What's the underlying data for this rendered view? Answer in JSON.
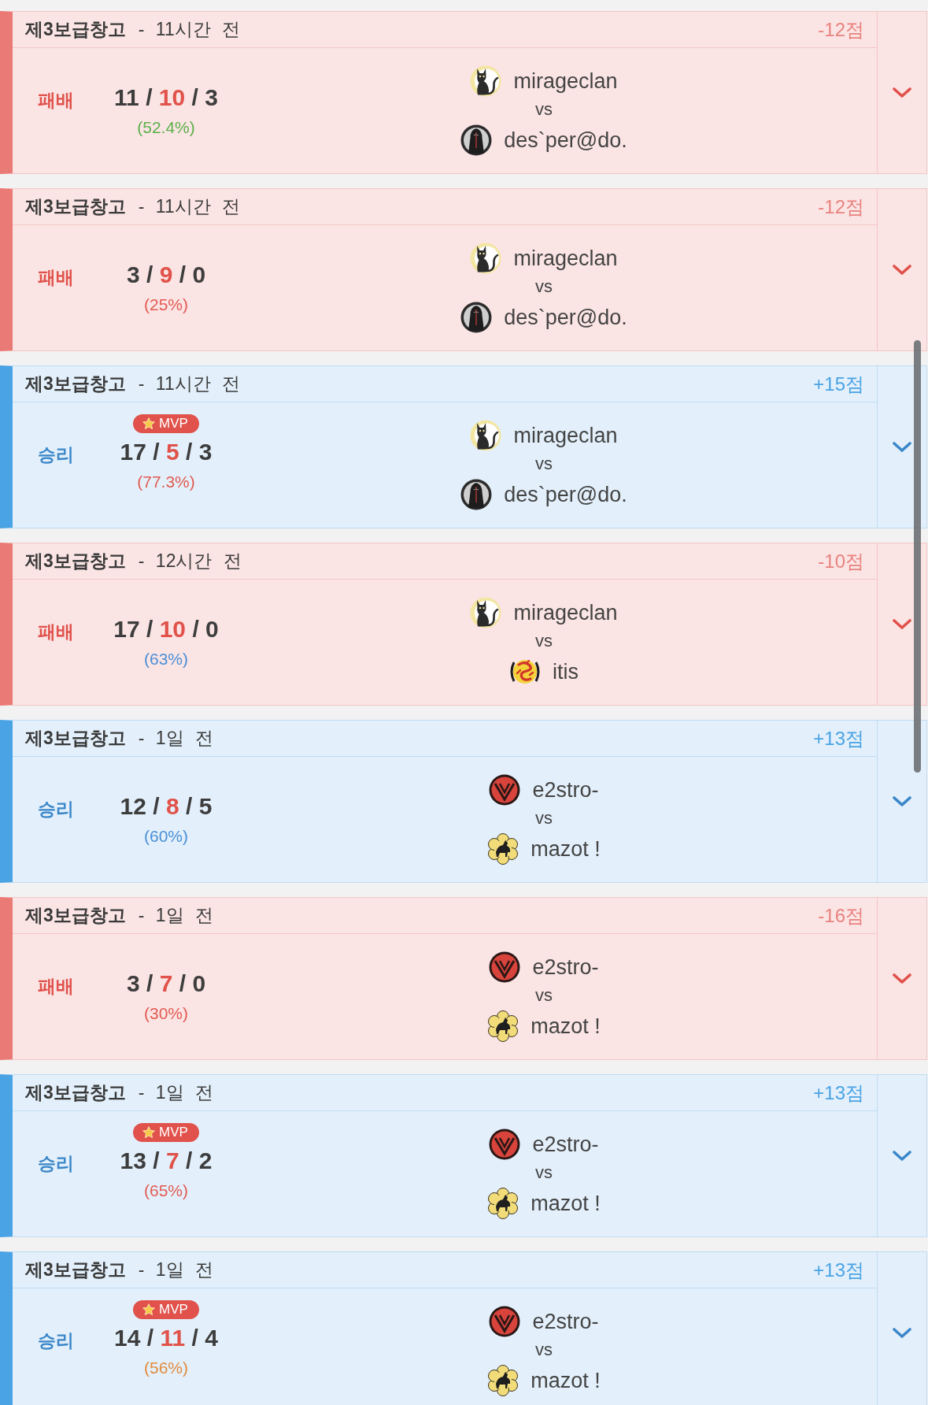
{
  "matches": [
    {
      "kind": "loss",
      "map": "제3보급창고",
      "time": "- 11시간 전",
      "score": "-12점",
      "result": "패배",
      "kda": [
        {
          "kind": "kills",
          "text": "11"
        },
        {
          "kind": "sep",
          "text": "/"
        },
        {
          "kind": "deaths",
          "text": "10"
        },
        {
          "kind": "sep",
          "text": "/"
        },
        {
          "kind": "assists",
          "text": "3"
        }
      ],
      "ratio": {
        "text": "(52.4%)",
        "color": "#5cb04a"
      },
      "teams": [
        {
          "name": "mirageclan",
          "kind": "cat"
        },
        {
          "name": "des`per@do.",
          "kind": "hooded"
        }
      ],
      "versus": "vs"
    },
    {
      "kind": "loss",
      "map": "제3보급창고",
      "time": "- 11시간 전",
      "score": "-12점",
      "result": "패배",
      "kda": [
        {
          "kind": "kills",
          "text": "3"
        },
        {
          "kind": "sep",
          "text": "/"
        },
        {
          "kind": "deaths",
          "text": "9"
        },
        {
          "kind": "sep",
          "text": "/"
        },
        {
          "kind": "assists",
          "text": "0"
        }
      ],
      "ratio": {
        "text": "(25%)",
        "color": "#e25b53"
      },
      "teams": [
        {
          "name": "mirageclan",
          "kind": "cat"
        },
        {
          "name": "des`per@do.",
          "kind": "hooded"
        }
      ],
      "versus": "vs"
    },
    {
      "kind": "win",
      "map": "제3보급창고",
      "time": "- 11시간 전",
      "score": "+15점",
      "result": "승리",
      "badge": "MVP",
      "kda": [
        {
          "kind": "kills",
          "text": "17"
        },
        {
          "kind": "sep",
          "text": "/"
        },
        {
          "kind": "deaths",
          "text": "5"
        },
        {
          "kind": "sep",
          "text": "/"
        },
        {
          "kind": "assists",
          "text": "3"
        }
      ],
      "ratio": {
        "text": "(77.3%)",
        "color": "#e25b53"
      },
      "teams": [
        {
          "name": "mirageclan",
          "kind": "cat"
        },
        {
          "name": "des`per@do.",
          "kind": "hooded"
        }
      ],
      "versus": "vs"
    },
    {
      "kind": "loss",
      "map": "제3보급창고",
      "time": "- 12시간 전",
      "score": "-10점",
      "result": "패배",
      "kda": [
        {
          "kind": "kills",
          "text": "17"
        },
        {
          "kind": "sep",
          "text": "/"
        },
        {
          "kind": "deaths",
          "text": "10"
        },
        {
          "kind": "sep",
          "text": "/"
        },
        {
          "kind": "assists",
          "text": "0"
        }
      ],
      "ratio": {
        "text": "(63%)",
        "color": "#4b8fd6"
      },
      "teams": [
        {
          "name": "mirageclan",
          "kind": "cat"
        },
        {
          "name": "itis",
          "kind": "dragon"
        }
      ],
      "versus": "vs"
    },
    {
      "kind": "win",
      "map": "제3보급창고",
      "time": "- 1일 전",
      "score": "+13점",
      "result": "승리",
      "kda": [
        {
          "kind": "kills",
          "text": "12"
        },
        {
          "kind": "sep",
          "text": "/"
        },
        {
          "kind": "deaths",
          "text": "8"
        },
        {
          "kind": "sep",
          "text": "/"
        },
        {
          "kind": "assists",
          "text": "5"
        }
      ],
      "ratio": {
        "text": "(60%)",
        "color": "#4b8fd6"
      },
      "teams": [
        {
          "name": "e2stro-",
          "kind": "vshield"
        },
        {
          "name": "mazot !",
          "kind": "flower"
        }
      ],
      "versus": "vs"
    },
    {
      "kind": "loss",
      "map": "제3보급창고",
      "time": "- 1일 전",
      "score": "-16점",
      "result": "패배",
      "kda": [
        {
          "kind": "kills",
          "text": "3"
        },
        {
          "kind": "sep",
          "text": "/"
        },
        {
          "kind": "deaths",
          "text": "7"
        },
        {
          "kind": "sep",
          "text": "/"
        },
        {
          "kind": "assists",
          "text": "0"
        }
      ],
      "ratio": {
        "text": "(30%)",
        "color": "#e25b53"
      },
      "teams": [
        {
          "name": "e2stro-",
          "kind": "vshield"
        },
        {
          "name": "mazot !",
          "kind": "flower"
        }
      ],
      "versus": "vs"
    },
    {
      "kind": "win",
      "map": "제3보급창고",
      "time": "- 1일 전",
      "score": "+13점",
      "result": "승리",
      "badge": "MVP",
      "kda": [
        {
          "kind": "kills",
          "text": "13"
        },
        {
          "kind": "sep",
          "text": "/"
        },
        {
          "kind": "deaths",
          "text": "7"
        },
        {
          "kind": "sep",
          "text": "/"
        },
        {
          "kind": "assists",
          "text": "2"
        }
      ],
      "ratio": {
        "text": "(65%)",
        "color": "#e25b53"
      },
      "teams": [
        {
          "name": "e2stro-",
          "kind": "vshield"
        },
        {
          "name": "mazot !",
          "kind": "flower"
        }
      ],
      "versus": "vs"
    },
    {
      "kind": "win",
      "map": "제3보급창고",
      "time": "- 1일 전",
      "score": "+13점",
      "result": "승리",
      "badge": "MVP",
      "kda": [
        {
          "kind": "kills",
          "text": "14"
        },
        {
          "kind": "sep",
          "text": "/"
        },
        {
          "kind": "deaths",
          "text": "11"
        },
        {
          "kind": "sep",
          "text": "/"
        },
        {
          "kind": "assists",
          "text": "4"
        }
      ],
      "ratio": {
        "text": "(56%)",
        "color": "#e28a3c"
      },
      "teams": [
        {
          "name": "e2stro-",
          "kind": "vshield"
        },
        {
          "name": "mazot !",
          "kind": "flower"
        }
      ],
      "versus": "vs"
    }
  ]
}
